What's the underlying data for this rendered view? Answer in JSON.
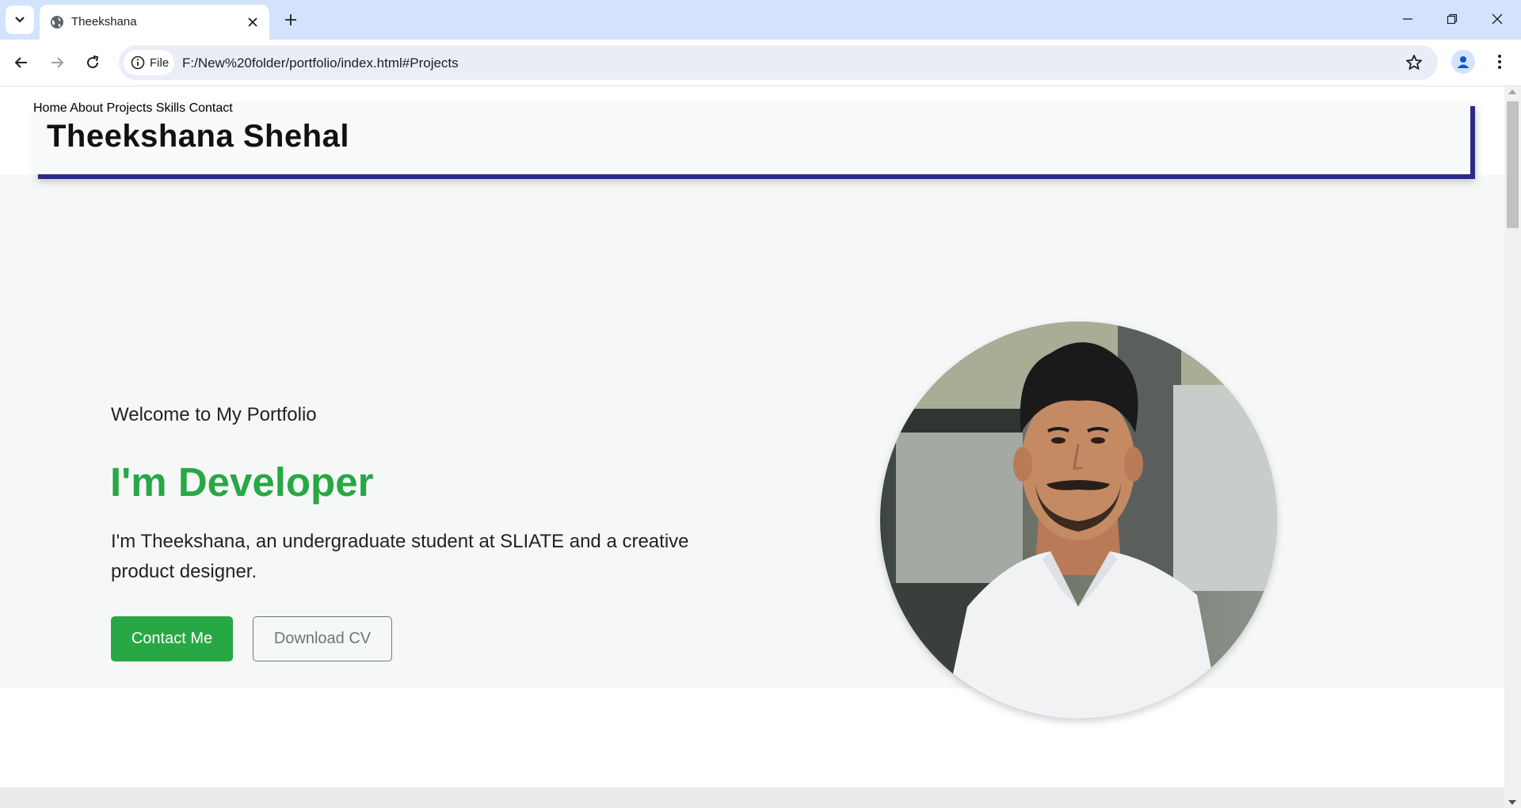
{
  "browser": {
    "tab_title": "Theekshana",
    "url_chip": "File",
    "url": "F:/New%20folder/portfolio/index.html#Projects"
  },
  "site": {
    "brand": "Theekshana Shehal",
    "nav": [
      "Home",
      "About",
      "Projects",
      "Skills",
      "Contact"
    ],
    "hero": {
      "welcome": "Welcome to My Portfolio",
      "headline": "I'm Developer",
      "intro": "I'm Theekshana, an undergraduate student at SLIATE and a creative product designer.",
      "contact_button": "Contact Me",
      "cv_button": "Download CV"
    }
  },
  "colors": {
    "accent_green": "#28a745",
    "header_shadow": "#2d2a86",
    "tabstrip": "#d3e3fd"
  },
  "icons": [
    "tab-search-icon",
    "globe-icon",
    "close-icon",
    "plus-icon",
    "minimize-icon",
    "restore-icon",
    "window-close-icon",
    "back-icon",
    "forward-icon",
    "reload-icon",
    "info-icon",
    "star-icon",
    "profile-icon",
    "menu-icon"
  ]
}
